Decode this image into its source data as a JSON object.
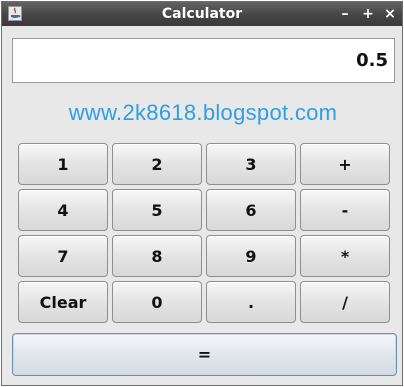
{
  "window": {
    "title": "Calculator",
    "minimize_label": "–",
    "maximize_label": "+",
    "close_label": "×"
  },
  "display": {
    "value": "0.5"
  },
  "banner": {
    "text": "www.2k8618.blogspot.com",
    "color": "#2e9fe6"
  },
  "keypad": {
    "keys": [
      "1",
      "2",
      "3",
      "+",
      "4",
      "5",
      "6",
      "-",
      "7",
      "8",
      "9",
      "*",
      "Clear",
      "0",
      ".",
      "/"
    ]
  },
  "equals_label": "="
}
